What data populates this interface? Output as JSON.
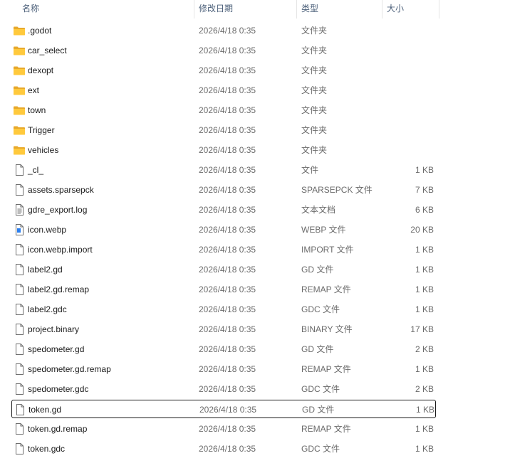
{
  "header": {
    "name": "名称",
    "date": "修改日期",
    "type": "类型",
    "size": "大小",
    "sort_arrow": "^"
  },
  "files": [
    {
      "name": ".godot",
      "date": "2026/4/18 0:35",
      "type": "文件夹",
      "size": "",
      "icon": "folder-icon"
    },
    {
      "name": "car_select",
      "date": "2026/4/18 0:35",
      "type": "文件夹",
      "size": "",
      "icon": "folder-icon"
    },
    {
      "name": "dexopt",
      "date": "2026/4/18 0:35",
      "type": "文件夹",
      "size": "",
      "icon": "folder-icon"
    },
    {
      "name": "ext",
      "date": "2026/4/18 0:35",
      "type": "文件夹",
      "size": "",
      "icon": "folder-icon"
    },
    {
      "name": "town",
      "date": "2026/4/18 0:35",
      "type": "文件夹",
      "size": "",
      "icon": "folder-icon"
    },
    {
      "name": "Trigger",
      "date": "2026/4/18 0:35",
      "type": "文件夹",
      "size": "",
      "icon": "folder-icon"
    },
    {
      "name": "vehicles",
      "date": "2026/4/18 0:35",
      "type": "文件夹",
      "size": "",
      "icon": "folder-icon"
    },
    {
      "name": "_cl_",
      "date": "2026/4/18 0:35",
      "type": "文件",
      "size": "1 KB",
      "icon": "file-icon"
    },
    {
      "name": "assets.sparsepck",
      "date": "2026/4/18 0:35",
      "type": "SPARSEPCK 文件",
      "size": "7 KB",
      "icon": "file-icon"
    },
    {
      "name": "gdre_export.log",
      "date": "2026/4/18 0:35",
      "type": "文本文档",
      "size": "6 KB",
      "icon": "text-file-icon"
    },
    {
      "name": "icon.webp",
      "date": "2026/4/18 0:35",
      "type": "WEBP 文件",
      "size": "20 KB",
      "icon": "image-file-icon"
    },
    {
      "name": "icon.webp.import",
      "date": "2026/4/18 0:35",
      "type": "IMPORT 文件",
      "size": "1 KB",
      "icon": "file-icon"
    },
    {
      "name": "label2.gd",
      "date": "2026/4/18 0:35",
      "type": "GD 文件",
      "size": "1 KB",
      "icon": "file-icon"
    },
    {
      "name": "label2.gd.remap",
      "date": "2026/4/18 0:35",
      "type": "REMAP 文件",
      "size": "1 KB",
      "icon": "file-icon"
    },
    {
      "name": "label2.gdc",
      "date": "2026/4/18 0:35",
      "type": "GDC 文件",
      "size": "1 KB",
      "icon": "file-icon"
    },
    {
      "name": "project.binary",
      "date": "2026/4/18 0:35",
      "type": "BINARY 文件",
      "size": "17 KB",
      "icon": "file-icon"
    },
    {
      "name": "spedometer.gd",
      "date": "2026/4/18 0:35",
      "type": "GD 文件",
      "size": "2 KB",
      "icon": "file-icon"
    },
    {
      "name": "spedometer.gd.remap",
      "date": "2026/4/18 0:35",
      "type": "REMAP 文件",
      "size": "1 KB",
      "icon": "file-icon"
    },
    {
      "name": "spedometer.gdc",
      "date": "2026/4/18 0:35",
      "type": "GDC 文件",
      "size": "2 KB",
      "icon": "file-icon"
    },
    {
      "name": "token.gd",
      "date": "2026/4/18 0:35",
      "type": "GD 文件",
      "size": "1 KB",
      "icon": "file-icon",
      "selected": true
    },
    {
      "name": "token.gd.remap",
      "date": "2026/4/18 0:35",
      "type": "REMAP 文件",
      "size": "1 KB",
      "icon": "file-icon"
    },
    {
      "name": "token.gdc",
      "date": "2026/4/18 0:35",
      "type": "GDC 文件",
      "size": "1 KB",
      "icon": "file-icon"
    }
  ]
}
